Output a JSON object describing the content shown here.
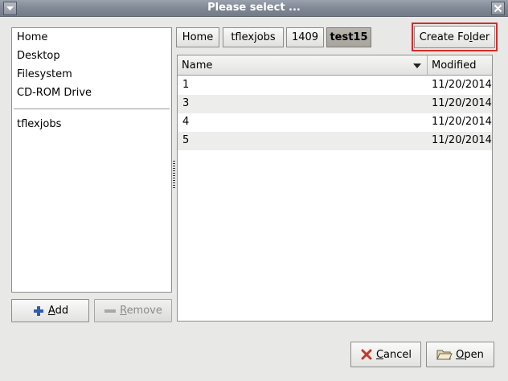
{
  "window": {
    "title": "Please select ...",
    "menu_icon": "window-menu-icon",
    "close_glyph": "×"
  },
  "places": {
    "items": [
      {
        "label": "Home"
      },
      {
        "label": "Desktop"
      },
      {
        "label": "Filesystem"
      },
      {
        "label": "CD-ROM Drive"
      }
    ],
    "bookmarks": [
      {
        "label": "tflexjobs"
      }
    ],
    "add_button": {
      "label_pre": "",
      "label_u": "A",
      "label_post": "dd",
      "icon": "plus-icon"
    },
    "remove_button": {
      "label_pre": "",
      "label_u": "R",
      "label_post": "emove",
      "icon": "minus-icon"
    }
  },
  "path_bar": {
    "crumbs": [
      "Home",
      "tflexjobs",
      "1409",
      "test15"
    ],
    "active_index": 3
  },
  "create_folder": {
    "label_pre": "Create Fo",
    "label_u": "l",
    "label_post": "der"
  },
  "file_list": {
    "columns": {
      "name": "Name",
      "modified": "Modified"
    },
    "rows": [
      {
        "name": "1",
        "modified": "11/20/2014"
      },
      {
        "name": "3",
        "modified": "11/20/2014"
      },
      {
        "name": "4",
        "modified": "11/20/2014"
      },
      {
        "name": "5",
        "modified": "11/20/2014"
      }
    ]
  },
  "actions": {
    "cancel": {
      "label_pre": "",
      "label_u": "C",
      "label_post": "ancel",
      "icon": "cancel-x-icon"
    },
    "open": {
      "label_pre": "",
      "label_u": "O",
      "label_post": "pen",
      "icon": "open-folder-icon"
    }
  },
  "colors": {
    "highlight": "#d62b2b",
    "alt_row": "#ededec",
    "cancel_icon": "#c0392b"
  }
}
